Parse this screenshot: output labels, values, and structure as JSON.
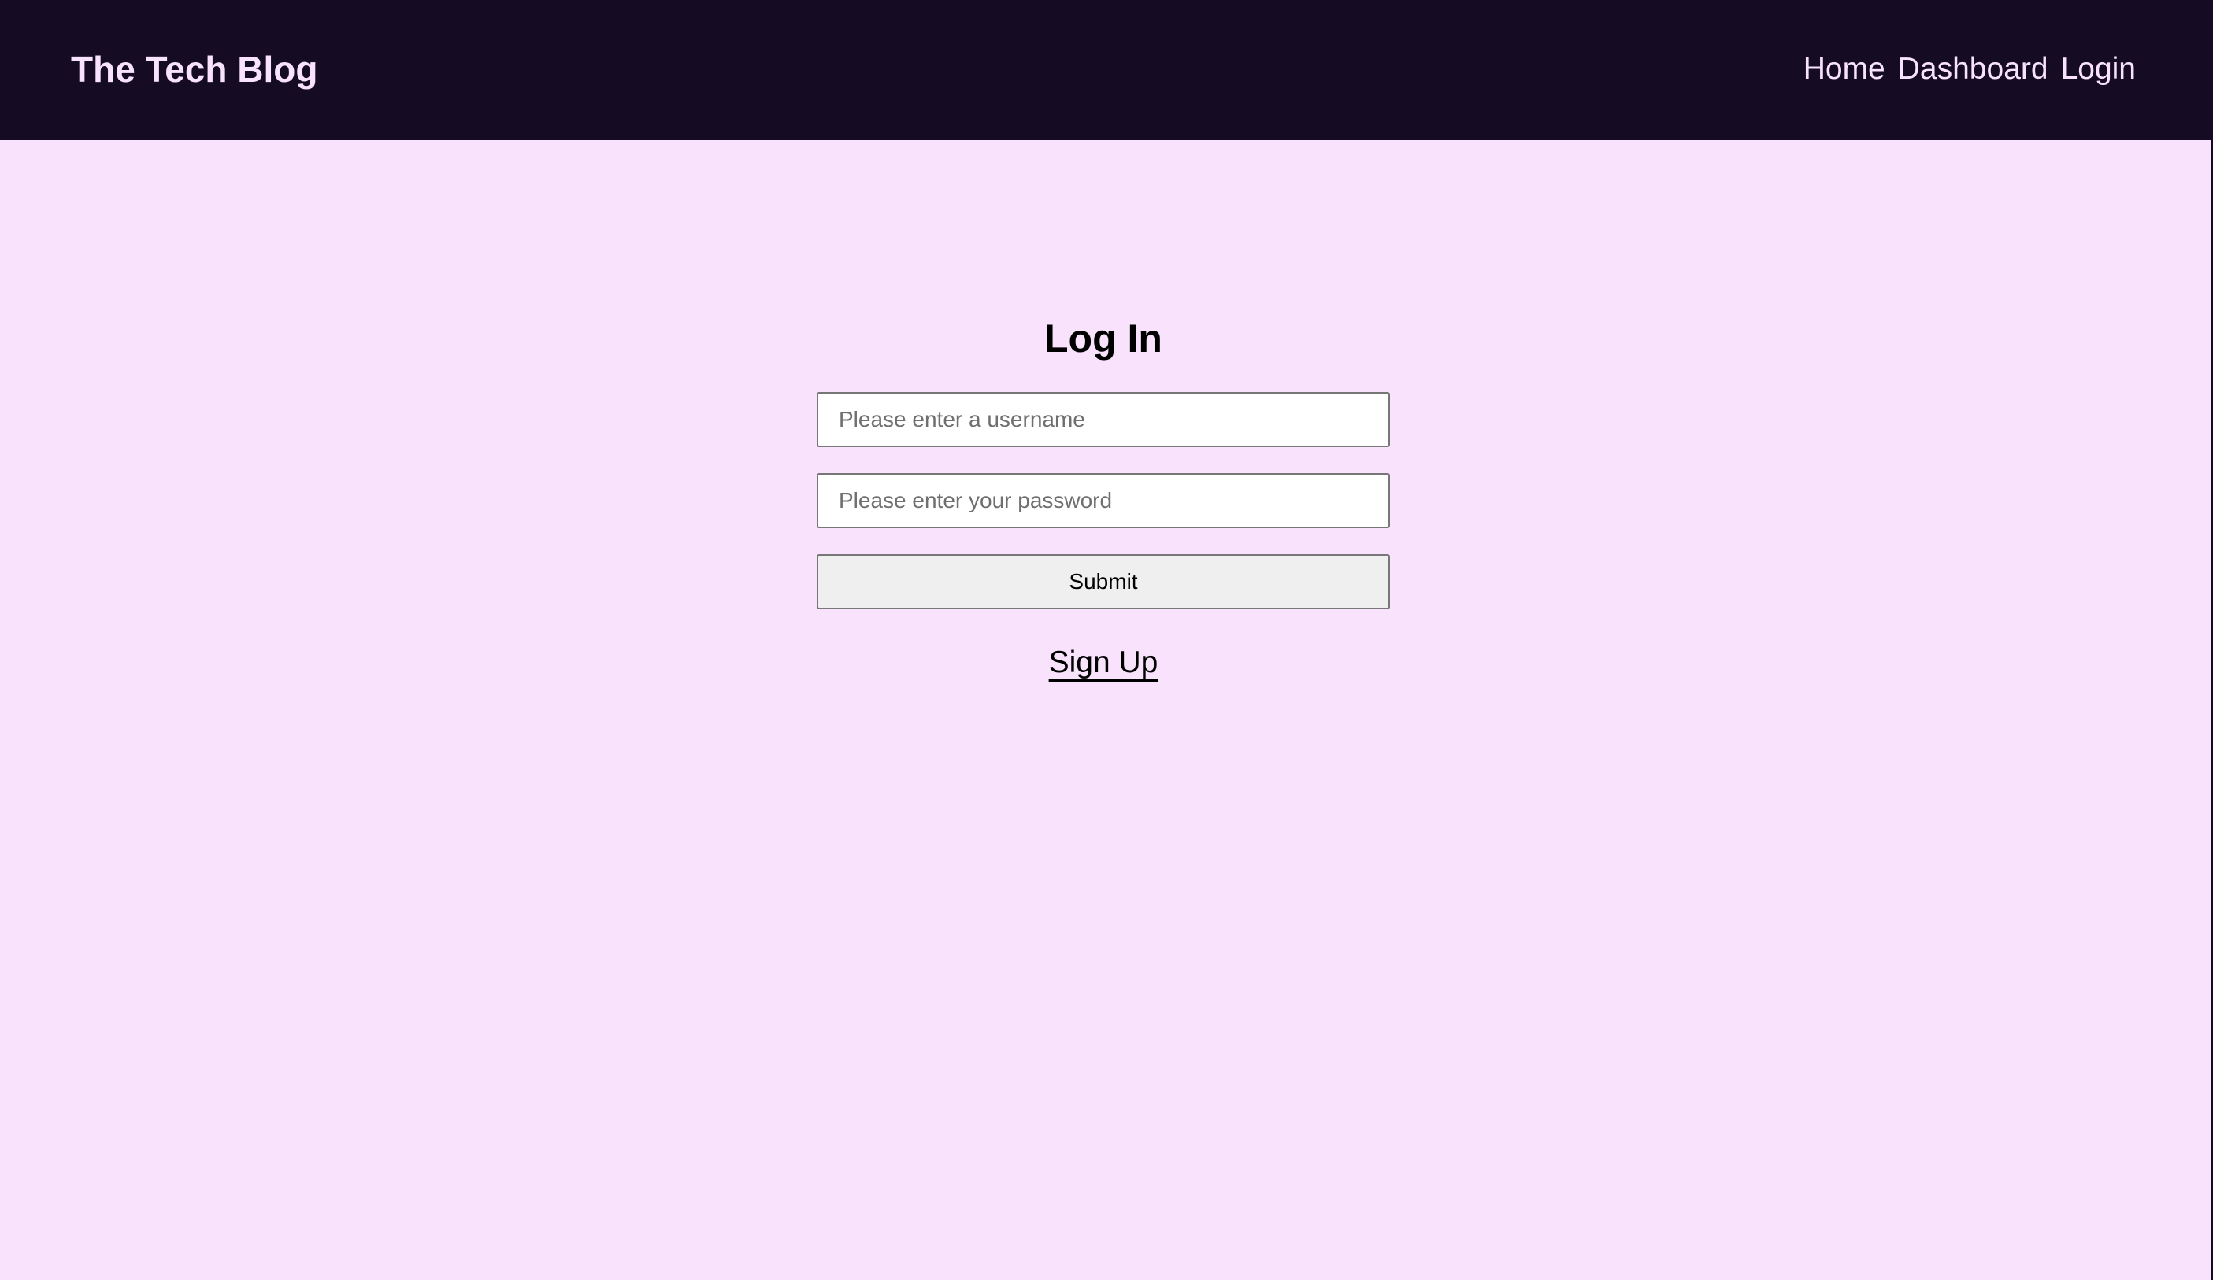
{
  "header": {
    "brand": "The Tech Blog",
    "nav": [
      {
        "label": "Home"
      },
      {
        "label": "Dashboard"
      },
      {
        "label": "Login"
      }
    ]
  },
  "login": {
    "title": "Log In",
    "username": {
      "value": "",
      "placeholder": "Please enter a username"
    },
    "password": {
      "value": "",
      "placeholder": "Please enter your password"
    },
    "submit_label": "Submit",
    "signup_label": "Sign Up"
  },
  "colors": {
    "header_background": "#150c24",
    "page_background": "#f8e2fc",
    "header_text": "#f8e2fc",
    "button_background": "#efefef"
  }
}
